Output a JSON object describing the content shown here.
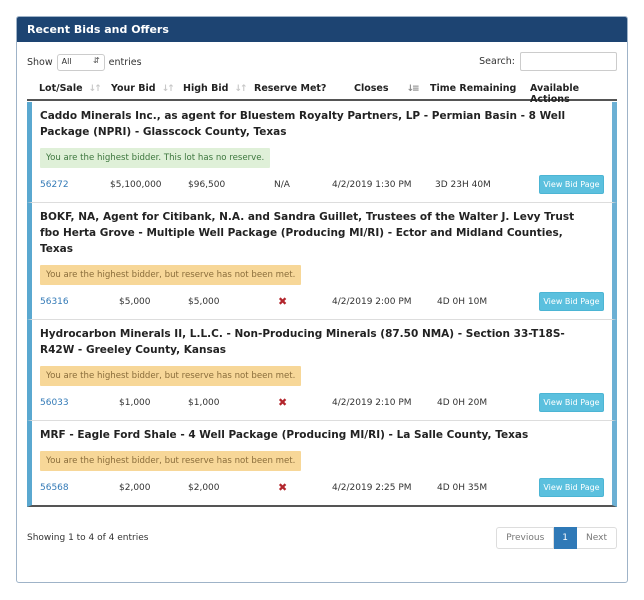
{
  "panel": {
    "title": "Recent Bids and Offers"
  },
  "toolbar": {
    "show_label": "Show",
    "length_value": "All",
    "entries_label": "entries",
    "search_label": "Search:",
    "search_value": ""
  },
  "columns": [
    {
      "label": "Lot/Sale",
      "sortable": true
    },
    {
      "label": "Your Bid",
      "sortable": true
    },
    {
      "label": "High Bid",
      "sortable": true
    },
    {
      "label": "Reserve Met?",
      "sortable": false
    },
    {
      "label": "Closes",
      "sortable": true,
      "sorted": "asc"
    },
    {
      "label": "Time Remaining",
      "sortable": false
    },
    {
      "label": "Available Actions",
      "sortable": false
    }
  ],
  "icons": {
    "sort": "sort-icon",
    "sort_asc": "sort-asc-icon",
    "reserve_not_met": "x-mark-icon",
    "select_arrow": "updown-arrow-icon"
  },
  "rows": [
    {
      "title": "Caddo Minerals Inc., as agent for Bluestem Royalty Partners, LP - Permian Basin - 8 Well Package (NPRI) - Glasscock County, Texas",
      "status": "You are the highest bidder. This lot has no reserve.",
      "status_type": "success",
      "lot": "56272",
      "your_bid": "$5,100,000",
      "high_bid": "$96,500",
      "reserve_met": "N/A",
      "closes": "4/2/2019 1:30 PM",
      "time_remaining": "3D 23H 40M",
      "action": "View Bid Page"
    },
    {
      "title": "BOKF, NA, Agent for Citibank, N.A. and Sandra Guillet, Trustees of the Walter J. Levy Trust fbo Herta Grove - Multiple Well Package (Producing MI/RI) - Ector and Midland Counties, Texas",
      "status": "You are the highest bidder, but reserve has not been met.",
      "status_type": "warning",
      "lot": "56316",
      "your_bid": "$5,000",
      "high_bid": "$5,000",
      "reserve_met": "✖",
      "closes": "4/2/2019 2:00 PM",
      "time_remaining": "4D 0H 10M",
      "action": "View Bid Page"
    },
    {
      "title": "Hydrocarbon Minerals II, L.L.C. - Non-Producing Minerals (87.50 NMA) - Section 33-T18S-R42W - Greeley County, Kansas",
      "status": "You are the highest bidder, but reserve has not been met.",
      "status_type": "warning",
      "lot": "56033",
      "your_bid": "$1,000",
      "high_bid": "$1,000",
      "reserve_met": "✖",
      "closes": "4/2/2019 2:10 PM",
      "time_remaining": "4D 0H 20M",
      "action": "View Bid Page"
    },
    {
      "title": "MRF - Eagle Ford Shale - 4 Well Package (Producing MI/RI) - La Salle County, Texas",
      "status": "You are the highest bidder, but reserve has not been met.",
      "status_type": "warning",
      "lot": "56568",
      "your_bid": "$2,000",
      "high_bid": "$2,000",
      "reserve_met": "✖",
      "closes": "4/2/2019 2:25 PM",
      "time_remaining": "4D 0H 35M",
      "action": "View Bid Page"
    }
  ],
  "footer": {
    "info": "Showing 1 to 4 of 4 entries",
    "previous_label": "Previous",
    "current_page": "1",
    "next_label": "Next"
  },
  "colors": {
    "header_bg": "#1d4472",
    "row_accent": "#5aa8d0",
    "button_info": "#5bc0de",
    "alert_success_bg": "#dff0d8",
    "alert_warning_bg": "#f7d798",
    "link": "#337ab7",
    "page_active": "#2f79b7",
    "x_mark": "#b3262d"
  }
}
